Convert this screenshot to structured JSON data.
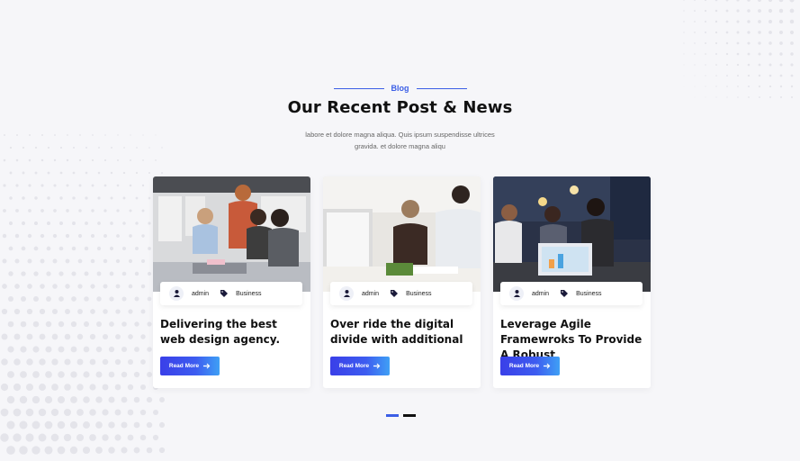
{
  "header": {
    "eyebrow": "Blog",
    "title": "Our Recent Post & News",
    "subtitle": "labore et dolore magna aliqua. Quis ipsum suspendisse ultrices gravida. et dolore magna aliqu"
  },
  "posts": [
    {
      "author": "admin",
      "category": "Business",
      "title": "Delivering the best web design agency.",
      "cta": "Read More"
    },
    {
      "author": "admin",
      "category": "Business",
      "title": "Over ride the digital divide with additional",
      "cta": "Read More"
    },
    {
      "author": "admin",
      "category": "Business",
      "title": "Leverage Agile Framewroks To Provide A Robust",
      "cta": "Read More"
    }
  ],
  "icons": {
    "author": "user-icon",
    "category": "tag-icon",
    "cta": "arrow-right-icon"
  },
  "colors": {
    "accent": "#3b5ee6",
    "title": "#111111",
    "background": "#f6f6f9"
  },
  "pagination": {
    "pages": 2,
    "active": 1
  }
}
